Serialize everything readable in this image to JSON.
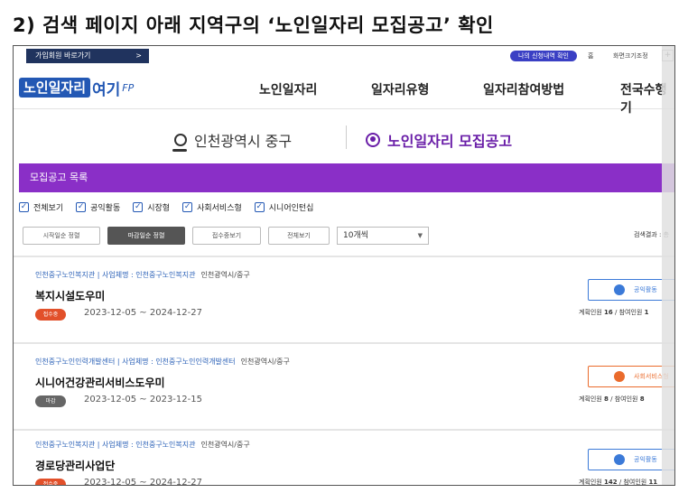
{
  "slide_title": "2) 검색 페이지 아래 지역구의 ‘노인일자리 모집공고’ 확인",
  "utility": {
    "join_label": "가입회원 바로가기",
    "join_arrow": ">",
    "my_pill": "나의 신청내역 확인",
    "util_home": "홈",
    "util_font": "화면크기조정",
    "plus": "+",
    "cut": "원"
  },
  "logo": {
    "main": "노인일자리",
    "tail": "여기",
    "mark": "FP"
  },
  "nav": [
    "노인일자리",
    "일자리유형",
    "일자리참여방법",
    "전국수행기"
  ],
  "region": {
    "location": "인천광역시 중구",
    "section": "노인일자리 모집공고"
  },
  "list_title": "모집공고 목록",
  "filters": [
    "전체보기",
    "공익활동",
    "시장형",
    "사회서비스형",
    "시니어인턴십"
  ],
  "sort_buttons": [
    "시작일순 정렬",
    "마감일순 정렬",
    "접수중보기",
    "전체보기"
  ],
  "page_size": "10개씩",
  "result_label": "검색결과 : 총",
  "listings": [
    {
      "agency": "인천중구노인복지관 | 사업체명 : 인천중구노인복지관",
      "region": "인천광역시/중구",
      "title": "복지시설도우미",
      "status": "접수중",
      "period": "2023-12-05 ~ 2024-12-27",
      "type": "공익활동",
      "counts_plan": "계획인원",
      "plan": "16",
      "counts_join": "/ 참여인원",
      "join": "1"
    },
    {
      "agency": "인천중구노인인력개발센터 | 사업체명 : 인천중구노인인력개발센터",
      "region": "인천광역시/중구",
      "title": "시니어건강관리서비스도우미",
      "status": "마감",
      "period": "2023-12-05 ~ 2023-12-15",
      "type": "사회서비스형",
      "counts_plan": "계획인원",
      "plan": "8",
      "counts_join": "/ 참여인원",
      "join": "8"
    },
    {
      "agency": "인천중구노인복지관 | 사업체명 : 인천중구노인복지관",
      "region": "인천광역시/중구",
      "title": "경로당관리사업단",
      "status": "접수중",
      "period": "2023-12-05 ~ 2024-12-27",
      "type": "공익활동",
      "counts_plan": "계획인원",
      "plan": "142",
      "counts_join": "/ 참여인원",
      "join": "11"
    }
  ],
  "colors": {
    "accent": "#8a2fc7",
    "brand": "#2358b4",
    "status_open": "#e2502a",
    "status_closed": "#666666",
    "type_public": "#3b7ad8",
    "type_social": "#ea6b2c"
  },
  "icons": [
    "location-pin-icon",
    "person-circle-icon",
    "check-icon",
    "caret-down-icon",
    "gear-icon"
  ]
}
